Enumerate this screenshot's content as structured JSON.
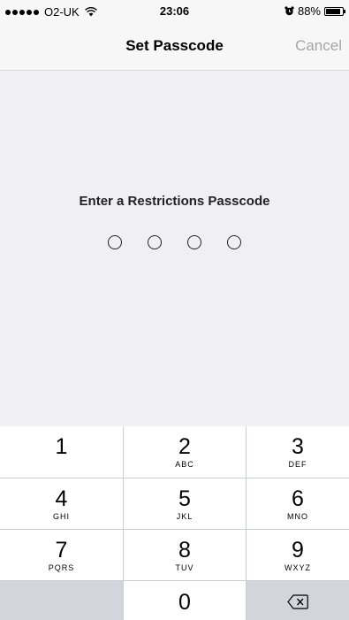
{
  "status_bar": {
    "carrier": "O2-UK",
    "time": "23:06",
    "battery_percent": "88%",
    "battery_level": 0.88,
    "icons": [
      "signal-dots",
      "wifi-icon",
      "alarm-icon",
      "battery-icon"
    ]
  },
  "nav": {
    "title": "Set Passcode",
    "cancel_label": "Cancel"
  },
  "content": {
    "prompt": "Enter a Restrictions Passcode",
    "passcode_length": 4
  },
  "keypad": {
    "keys": [
      {
        "digit": "1",
        "letters": ""
      },
      {
        "digit": "2",
        "letters": "ABC"
      },
      {
        "digit": "3",
        "letters": "DEF"
      },
      {
        "digit": "4",
        "letters": "GHI"
      },
      {
        "digit": "5",
        "letters": "JKL"
      },
      {
        "digit": "6",
        "letters": "MNO"
      },
      {
        "digit": "7",
        "letters": "PQRS"
      },
      {
        "digit": "8",
        "letters": "TUV"
      },
      {
        "digit": "9",
        "letters": "WXYZ"
      },
      {
        "digit": "0",
        "letters": ""
      }
    ],
    "delete_icon": "backspace-icon"
  },
  "colors": {
    "bar_background": "#f7f7f7",
    "content_background": "#efeff4",
    "cancel_disabled": "#a5a5a5",
    "keypad_separator": "#c9cdd2",
    "key_dark": "#d2d5db"
  }
}
